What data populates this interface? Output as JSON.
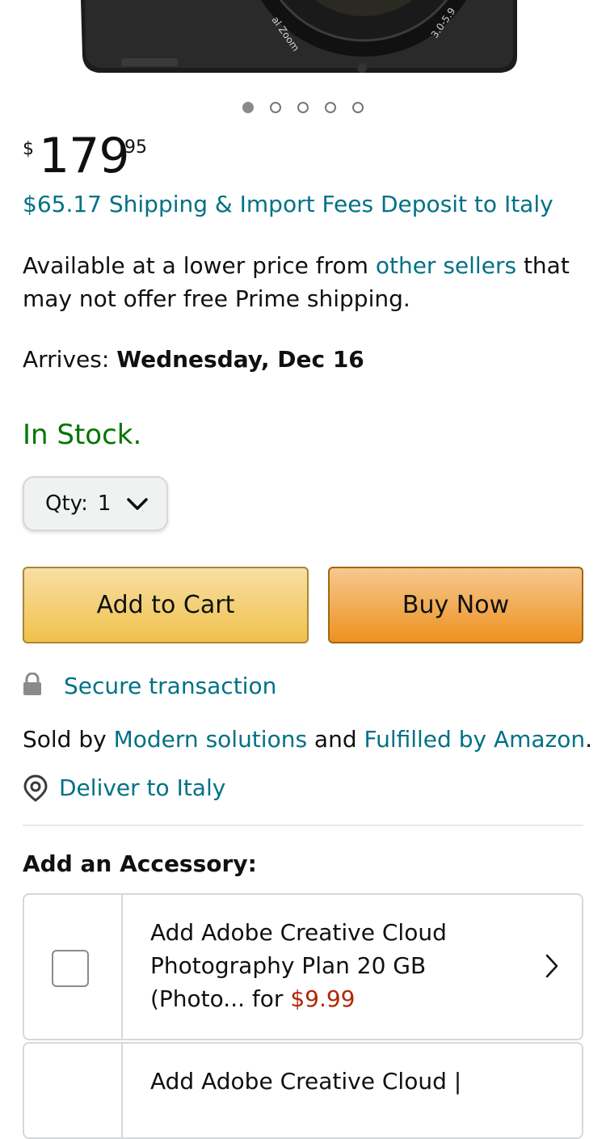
{
  "product": {
    "image_alt": "Camera",
    "lens_text_1": "al Zoom",
    "lens_text_2": "3.0-5.9"
  },
  "carousel": {
    "count": 5,
    "active": 0
  },
  "price": {
    "symbol": "$",
    "whole": "179",
    "fraction": "95"
  },
  "shipping_fees": "$65.17 Shipping & Import Fees Deposit to Italy",
  "lower_price": {
    "prefix": "Available at a lower price from ",
    "link": "other sellers",
    "suffix": " that may not offer free Prime shipping."
  },
  "arrives": {
    "label": "Arrives: ",
    "date": "Wednesday, Dec 16"
  },
  "stock_status": "In Stock.",
  "quantity": {
    "label": "Qty:",
    "value": "1"
  },
  "buttons": {
    "add_to_cart": "Add to Cart",
    "buy_now": "Buy Now"
  },
  "secure_transaction": "Secure transaction",
  "sold_by": {
    "prefix": "Sold by ",
    "seller": "Modern solutions",
    "middle": " and ",
    "fulfilled": "Fulfilled by Amazon",
    "suffix": "."
  },
  "deliver_to": "Deliver to Italy",
  "accessories": {
    "heading": "Add an Accessory:",
    "items": [
      {
        "title": "Add Adobe Creative Cloud Photography Plan 20 GB (Photo... for ",
        "price": "$9.99"
      },
      {
        "title": "Add Adobe Creative Cloud |",
        "price": ""
      }
    ]
  },
  "colors": {
    "link": "#007185",
    "in_stock": "#007600",
    "price_red": "#b12704",
    "add_to_cart_bg": "#f0c14b",
    "buy_now_bg": "#ed9220"
  }
}
